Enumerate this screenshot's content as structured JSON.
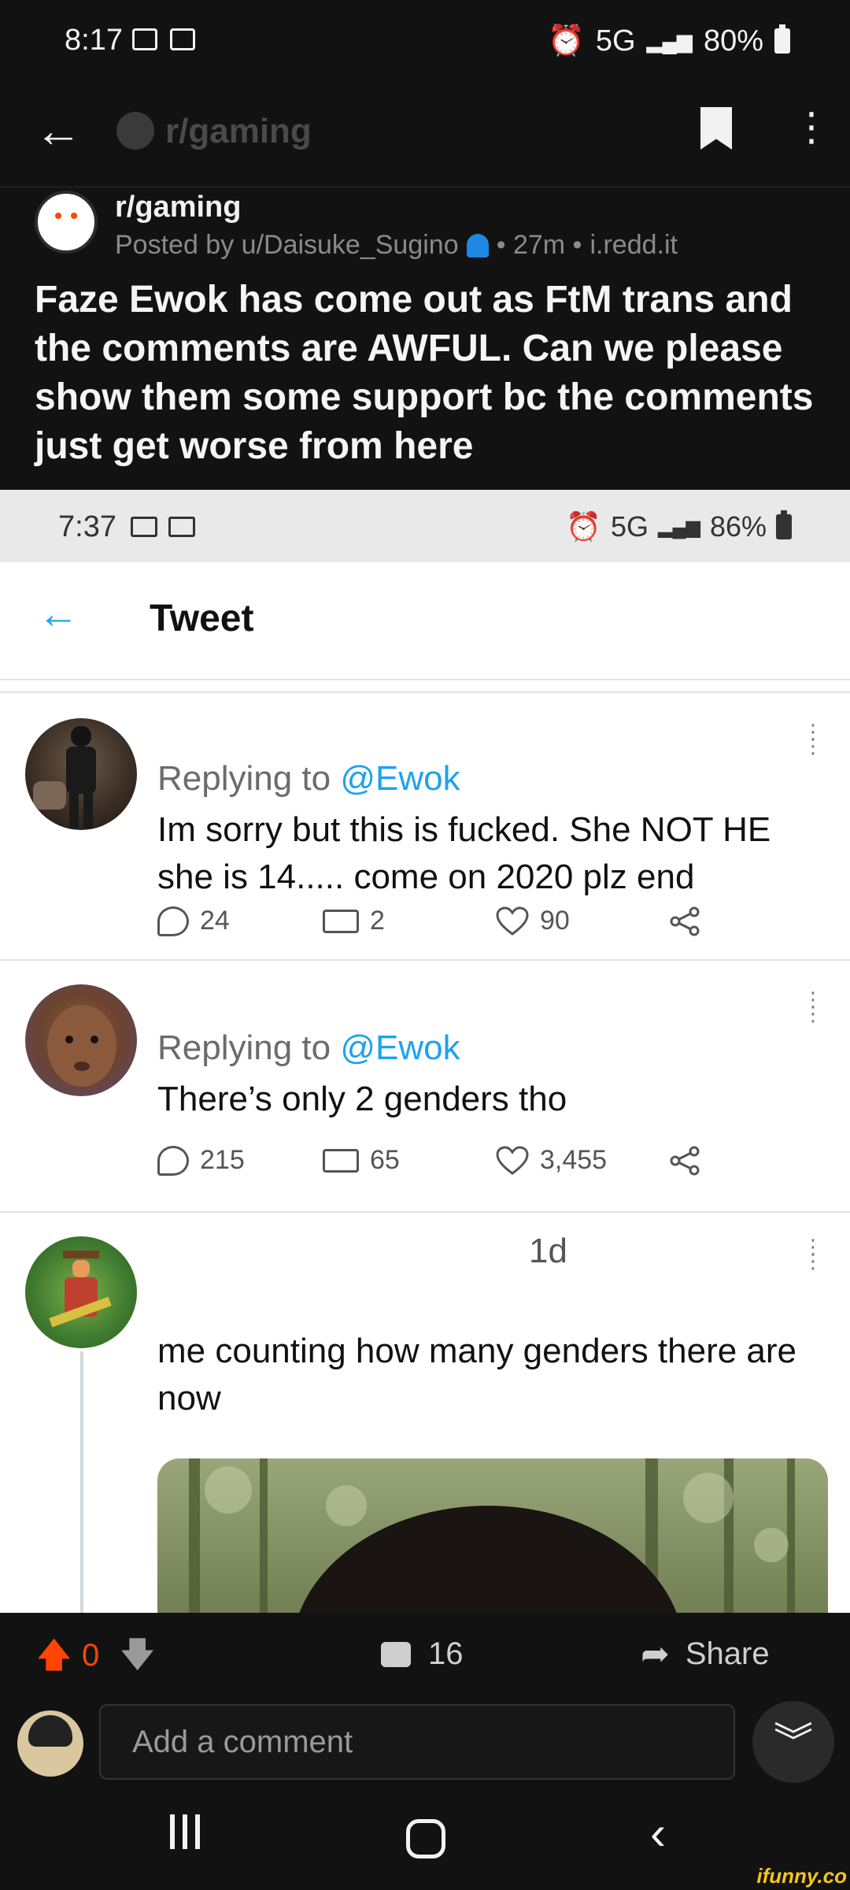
{
  "status_bar": {
    "time": "8:17",
    "network": "5G",
    "battery": "80%"
  },
  "app_header": {
    "subreddit": "r/gaming"
  },
  "post": {
    "subreddit": "r/gaming",
    "posted_by": "Posted by u/Daisuke_Sugino",
    "age": "• 27m •",
    "domain": "i.redd.it",
    "title": "Faze Ewok has come out as FtM trans and the comments are AWFUL. Can we please show them some support bc the comments just get worse from here"
  },
  "screenshot": {
    "status_bar": {
      "time": "7:37",
      "network": "5G",
      "battery": "86%"
    },
    "header_title": "Tweet",
    "tweets": [
      {
        "replying_prefix": "Replying to ",
        "handle": "@Ewok",
        "text": "Im sorry but this is fucked.  She NOT HE she is 14..... come on 2020 plz end",
        "replies": "24",
        "retweets": "2",
        "likes": "90"
      },
      {
        "replying_prefix": "Replying to ",
        "handle": "@Ewok",
        "text": "There’s only 2 genders tho",
        "replies": "215",
        "retweets": "65",
        "likes": "3,455"
      },
      {
        "time": "1d",
        "text": "me counting how many genders there are now"
      }
    ]
  },
  "bottom_bar": {
    "vote_count": "0",
    "comment_count": "16",
    "share_label": "Share",
    "comment_placeholder": "Add a comment"
  },
  "watermark": "ifunny.co",
  "colors": {
    "reddit_orange": "#ff4500",
    "twitter_blue": "#1da1f2",
    "dark_bg": "#121212"
  }
}
